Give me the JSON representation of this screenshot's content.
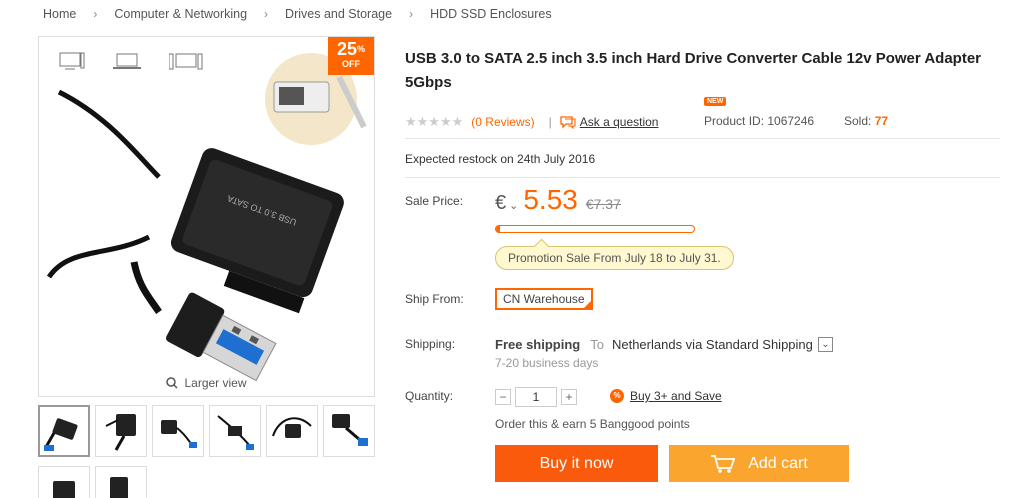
{
  "breadcrumb": [
    "Home",
    "Computer & Networking",
    "Drives and Storage",
    "HDD SSD Enclosures"
  ],
  "gallery": {
    "badge_pct": "25",
    "badge_pct_sign": "%",
    "badge_off": "OFF",
    "larger_view": "Larger view",
    "product_label_text": "USB 3.0 TO SATA"
  },
  "product": {
    "title": "USB 3.0 to SATA 2.5 inch 3.5 inch Hard Drive Converter Cable 12v Power Adapter 5Gbps",
    "stars": "★★★★★",
    "rating": 0,
    "reviews": "(0 Reviews)",
    "pipe": "|",
    "ask": "Ask a question",
    "new_badge": "NEW",
    "product_id": "Product ID: 1067246",
    "sold_label": "Sold:",
    "sold_value": "77",
    "restock": "Expected restock on 24th July 2016"
  },
  "price": {
    "label": "Sale Price:",
    "currency": "€",
    "caret": "⌄",
    "value": "5.53",
    "old": "€7.37",
    "progress_fraction": 0.02,
    "promo": "Promotion Sale From July 18 to July 31."
  },
  "ship_from": {
    "label": "Ship From:",
    "value": "CN Warehouse"
  },
  "shipping": {
    "label": "Shipping:",
    "free": "Free shipping",
    "to": "To",
    "destination": "Netherlands via Standard Shipping",
    "dropdown_icon": "⌄",
    "days": "7-20 business days"
  },
  "quantity": {
    "label": "Quantity:",
    "minus": "−",
    "value": "1",
    "plus": "+",
    "deal_icon": "%",
    "buy3": "Buy 3+ and Save",
    "points": "Order this & earn 5 Banggood points"
  },
  "buttons": {
    "buy": "Buy it now",
    "cart": "Add cart"
  },
  "colors": {
    "accent": "#ff6600",
    "buy_bg": "#f95a0b",
    "cart_bg": "#f9a52e"
  }
}
